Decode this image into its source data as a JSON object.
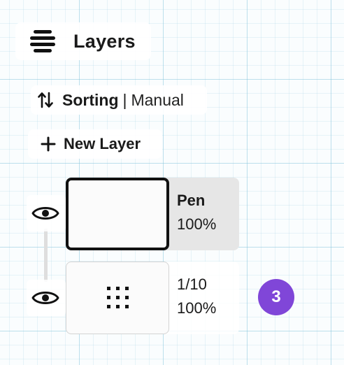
{
  "panel": {
    "title": "Layers",
    "menu_icon": "stack-menu-icon"
  },
  "sorting": {
    "icon": "sort-arrows-icon",
    "label": "Sorting",
    "separator": "|",
    "value": "Manual"
  },
  "new_layer": {
    "icon": "plus-icon",
    "label": "New Layer"
  },
  "layers": [
    {
      "name": "Pen",
      "opacity": "100%",
      "selected": true,
      "visible": true
    },
    {
      "name": "1/10",
      "opacity": "100%",
      "selected": false,
      "visible": true,
      "thumbnail_icon": "dot-grid-icon"
    }
  ],
  "badge": {
    "count": "3",
    "color": "#8046d8"
  },
  "colors": {
    "accent": "#8046d8",
    "selected_row": "#e6e6e6",
    "grid_line": "#9fd2e4"
  }
}
